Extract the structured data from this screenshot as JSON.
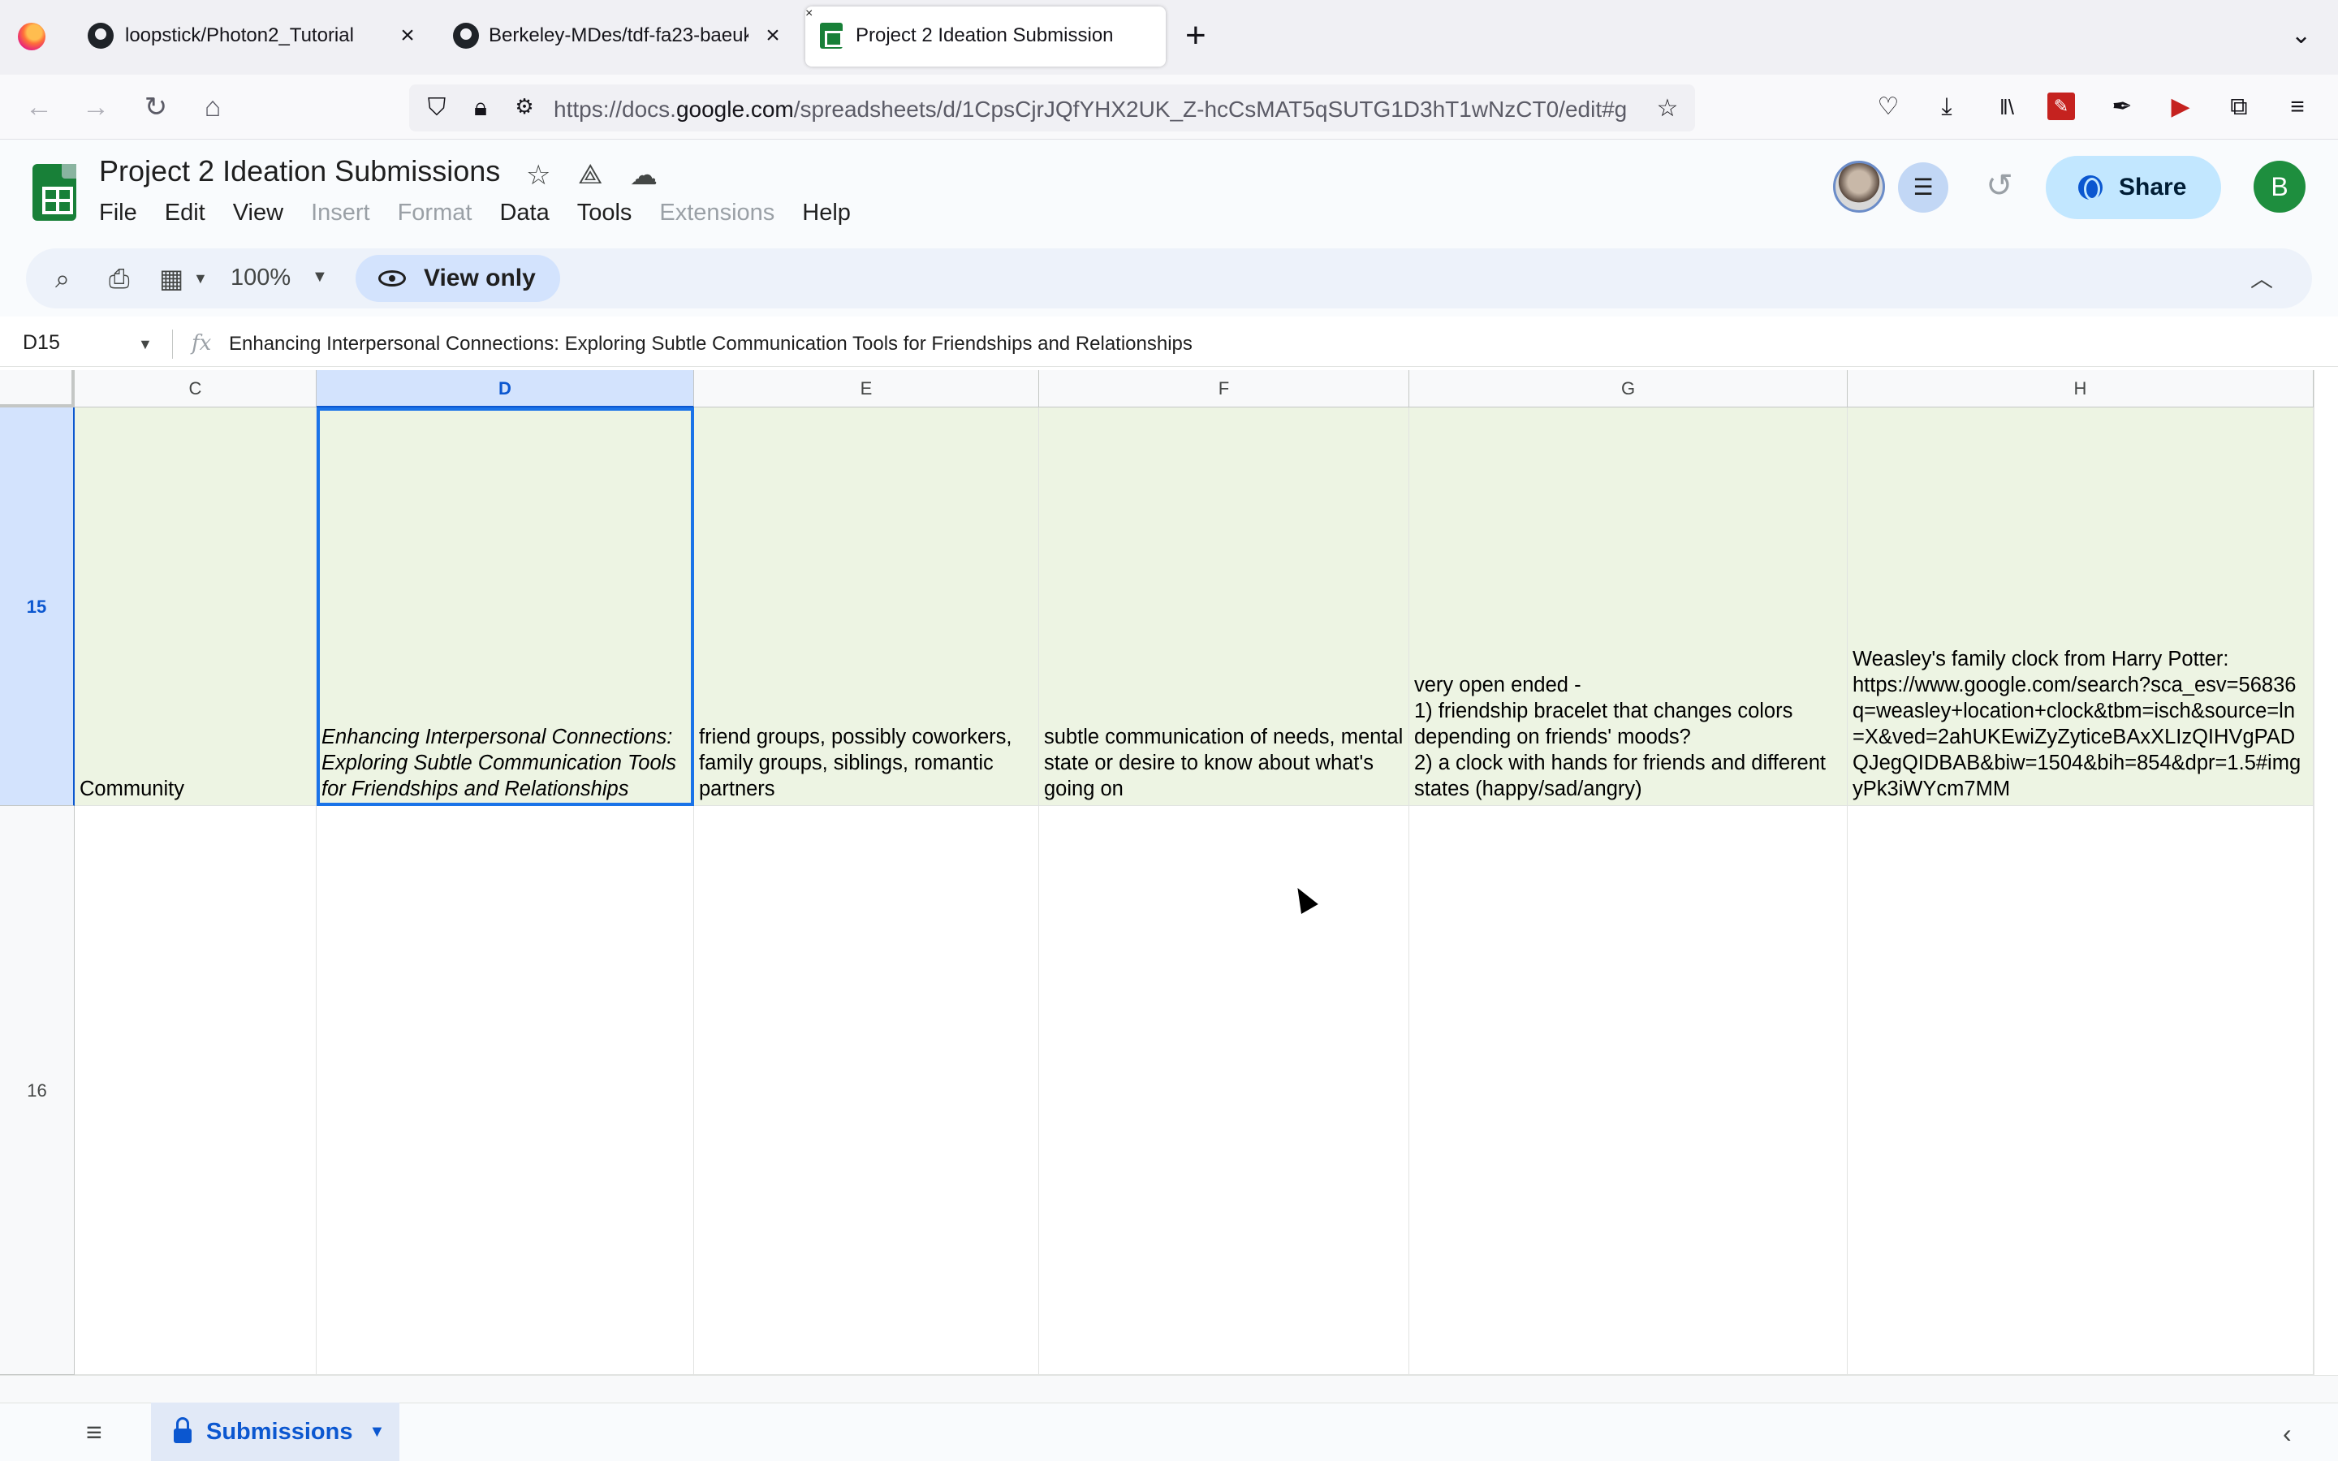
{
  "browser": {
    "tabs": [
      {
        "title": "loopstick/Photon2_Tutorial",
        "icon": "github-icon"
      },
      {
        "title": "Berkeley-MDes/tdf-fa23-baeuk",
        "icon": "github-icon"
      },
      {
        "title": "Project 2 Ideation Submissions",
        "icon": "google-sheets-icon",
        "active": true
      }
    ],
    "url_prefix": "https://docs.",
    "url_domain": "google.com",
    "url_rest": "/spreadsheets/d/1CpsCjrJQfYHX2UK_Z-hcCsMAT5qSUTG1D3hT1wNzCT0/edit#g"
  },
  "sheets": {
    "title": "Project 2 Ideation Submissions",
    "menu": [
      {
        "label": "File",
        "enabled": true
      },
      {
        "label": "Edit",
        "enabled": true
      },
      {
        "label": "View",
        "enabled": true
      },
      {
        "label": "Insert",
        "enabled": false
      },
      {
        "label": "Format",
        "enabled": false
      },
      {
        "label": "Data",
        "enabled": true
      },
      {
        "label": "Tools",
        "enabled": true
      },
      {
        "label": "Extensions",
        "enabled": false
      },
      {
        "label": "Help",
        "enabled": true
      }
    ],
    "share_label": "Share",
    "user_initial": "B",
    "zoom": "100%",
    "view_only_label": "View only",
    "namebox": "D15",
    "formula": "Enhancing Interpersonal Connections: Exploring Subtle Communication Tools for Friendships and Relationships",
    "columns": [
      "C",
      "D",
      "E",
      "F",
      "G",
      "H"
    ],
    "selected_column": "D",
    "rows": [
      {
        "number": "15",
        "selected": true,
        "cells": [
          "Community",
          "Enhancing Interpersonal Connections: Exploring Subtle Communication Tools for Friendships and Relationships",
          "friend groups, possibly coworkers, family groups, siblings, romantic partners",
          "subtle communication of needs, mental state or desire to know about what's going on",
          "very open ended -\n1) friendship bracelet that changes colors depending on friends' moods?\n2) a clock with hands for friends and different states (happy/sad/angry)",
          "Weasley's family clock from Harry Potter:\nhttps://www.google.com/search?sca_esv=56836\nq=weasley+location+clock&tbm=isch&source=ln\n=X&ved=2ahUKEwiZyZyticeBAxXLIzQIHVgPAD\nQJegQIDBAB&biw=1504&bih=854&dpr=1.5#img\nyPk3iWYcm7MM"
        ]
      },
      {
        "number": "16",
        "selected": false,
        "cells": [
          "",
          "",
          "",
          "",
          "",
          ""
        ]
      }
    ],
    "sheet_tab": "Submissions"
  },
  "colors": {
    "row_highlight": "#edf4e3",
    "selection": "#1a73e8",
    "share_bg": "#c2e7ff",
    "sheets_green": "#188038"
  }
}
